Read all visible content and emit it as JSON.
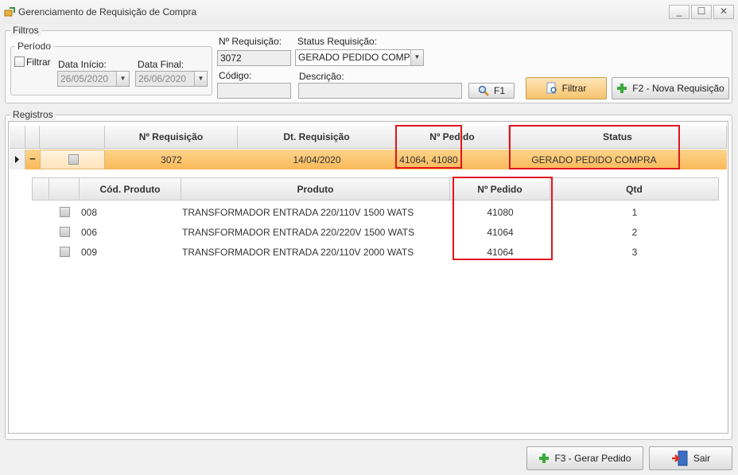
{
  "window": {
    "title": "Gerenciamento de Requisição de Compra",
    "controls": [
      "_",
      "☐",
      "✕"
    ]
  },
  "filters": {
    "group_label": "Filtros",
    "periodo": {
      "label": "Período",
      "filtrar_label": "Filtrar",
      "data_inicio_label": "Data Início:",
      "data_inicio_value": "26/05/2020",
      "data_final_label": "Data Final:",
      "data_final_value": "26/06/2020"
    },
    "n_requisicao_label": "Nº Requisição:",
    "n_requisicao_value": "3072",
    "status_label": "Status Requisição:",
    "status_value": "GERADO PEDIDO COMPR",
    "codigo_label": "Código:",
    "codigo_value": "",
    "descricao_label": "Descrição:",
    "descricao_value": "",
    "f1_label": "F1",
    "filtrar_button": "Filtrar",
    "nova_requisicao_button": "F2 - Nova Requisição"
  },
  "registros": {
    "group_label": "Registros",
    "columns": [
      "Nº Requisição",
      "Dt. Requisição",
      "Nº Pedido",
      "Status"
    ],
    "row": {
      "n_requisicao": "3072",
      "dt_requisicao": "14/04/2020",
      "n_pedido": "41064, 41080",
      "status": "GERADO PEDIDO COMPRA",
      "expand_symbol": "−"
    },
    "detail_columns": [
      "Cód. Produto",
      "Produto",
      "Nº Pedido",
      "Qtd"
    ],
    "detail_rows": [
      {
        "cod": "008",
        "produto": "TRANSFORMADOR ENTRADA 220/110V 1500 WATS",
        "pedido": "41080",
        "qtd": "1"
      },
      {
        "cod": "006",
        "produto": "TRANSFORMADOR ENTRADA 220/220V 1500 WATS",
        "pedido": "41064",
        "qtd": "2"
      },
      {
        "cod": "009",
        "produto": "TRANSFORMADOR ENTRADA 220/110V 2000 WATS",
        "pedido": "41064",
        "qtd": "3"
      }
    ]
  },
  "footer": {
    "gerar_pedido_button": "F3 - Gerar Pedido",
    "sair_button": "Sair"
  },
  "colors": {
    "selected_row": "#fcc36c",
    "highlight_box": "#e0141c",
    "accent_green": "#3aa83a"
  }
}
